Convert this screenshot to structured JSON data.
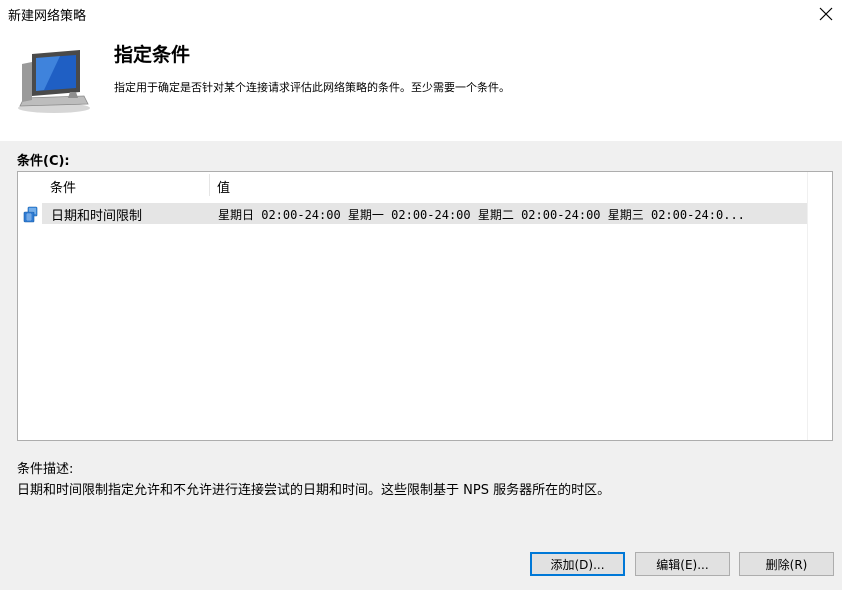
{
  "window": {
    "title": "新建网络策略",
    "close_label": "✕"
  },
  "header": {
    "title": "指定条件",
    "description": "指定用于确定是否针对某个连接请求评估此网络策略的条件。至少需要一个条件。"
  },
  "conditions": {
    "label": "条件(C):",
    "columns": [
      "条件",
      "值"
    ],
    "rows": [
      {
        "condition": "日期和时间限制",
        "value": "星期日 02:00-24:00 星期一 02:00-24:00 星期二 02:00-24:00 星期三 02:00-24:0..."
      }
    ]
  },
  "description": {
    "label": "条件描述:",
    "text": "日期和时间限制指定允许和不允许进行连接尝试的日期和时间。这些限制基于 NPS 服务器所在的时区。"
  },
  "buttons": {
    "add": "添加(D)...",
    "edit": "编辑(E)...",
    "delete": "删除(R)"
  },
  "colors": {
    "accent": "#0078d7",
    "selection": "#e5e5e5"
  }
}
